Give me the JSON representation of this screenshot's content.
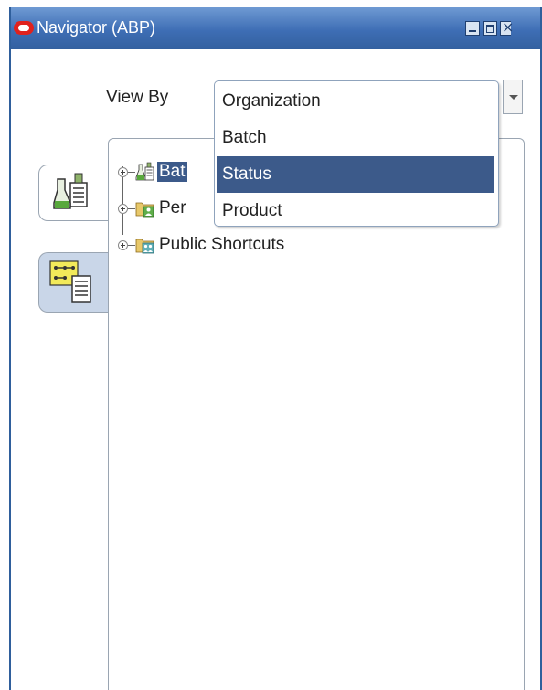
{
  "window": {
    "title": "Navigator (ABP)"
  },
  "view_by": {
    "label": "View By",
    "options": [
      {
        "label": "Organization"
      },
      {
        "label": "Batch"
      },
      {
        "label": "Status"
      },
      {
        "label": "Product"
      }
    ],
    "highlighted": "Status"
  },
  "tree": {
    "items": [
      {
        "label": "Bat",
        "icon": "flask-document-icon"
      },
      {
        "label": "Per",
        "icon": "folder-person-icon"
      },
      {
        "label": "Public Shortcuts",
        "icon": "folder-people-icon"
      }
    ]
  },
  "side_tabs": [
    {
      "icon": "flask-document-icon"
    },
    {
      "icon": "process-flow-document-icon"
    }
  ],
  "colors": {
    "title_bar": "#3e6eb5",
    "selection": "#3c5a8a",
    "logo_red": "#e0221e"
  }
}
